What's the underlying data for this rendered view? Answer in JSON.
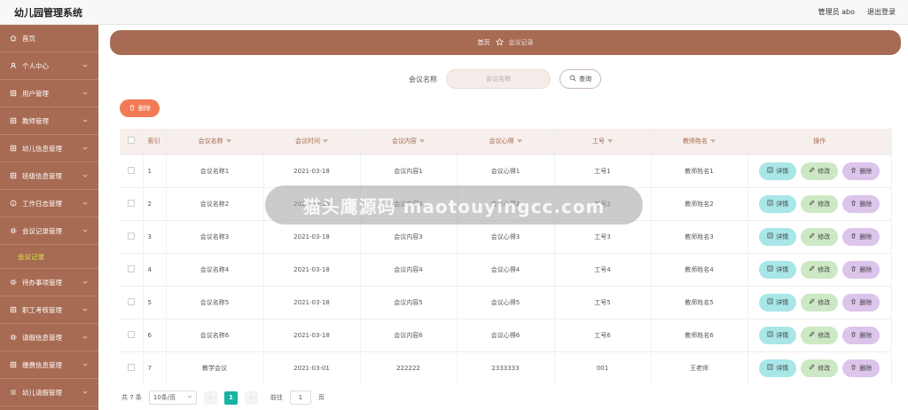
{
  "app": {
    "title": "幼儿园管理系统"
  },
  "header": {
    "user_label": "管理员 abo",
    "logout_label": "退出登录"
  },
  "sidebar": {
    "items": [
      {
        "label": "首页",
        "icon": "home-icon",
        "has_children": false
      },
      {
        "label": "个人中心",
        "icon": "user-icon",
        "has_children": true
      },
      {
        "label": "用户管理",
        "icon": "grid-icon",
        "has_children": true
      },
      {
        "label": "教师管理",
        "icon": "grid-icon",
        "has_children": true
      },
      {
        "label": "幼儿信息管理",
        "icon": "grid-icon",
        "has_children": true
      },
      {
        "label": "班级信息管理",
        "icon": "grid-icon",
        "has_children": true
      },
      {
        "label": "工作日志管理",
        "icon": "info-icon",
        "has_children": true
      },
      {
        "label": "会议记录管理",
        "icon": "gear-icon",
        "has_children": true,
        "expanded": true,
        "children": [
          {
            "label": "会议记录"
          }
        ]
      },
      {
        "label": "待办事项管理",
        "icon": "gear-icon",
        "has_children": true
      },
      {
        "label": "职工考核管理",
        "icon": "grid-icon",
        "has_children": true
      },
      {
        "label": "请假信息管理",
        "icon": "gear-icon",
        "has_children": true
      },
      {
        "label": "缴费信息管理",
        "icon": "grid-icon",
        "has_children": true
      },
      {
        "label": "幼儿请假管理",
        "icon": "list-icon",
        "has_children": true
      }
    ]
  },
  "breadcrumb": {
    "home": "首页",
    "current": "会议记录"
  },
  "search": {
    "label": "会议名称",
    "placeholder": "会议名称",
    "button_label": "查询"
  },
  "toolbar": {
    "delete_label": "删除"
  },
  "table": {
    "columns": [
      "索引",
      "会议名称",
      "会议时间",
      "会议内容",
      "会议心得",
      "工号",
      "教师姓名",
      "操作"
    ],
    "rows": [
      {
        "index": "1",
        "name": "会议名称1",
        "time": "2021-03-18",
        "content": "会议内容1",
        "insight": "会议心得1",
        "job_no": "工号1",
        "teacher": "教师姓名1"
      },
      {
        "index": "2",
        "name": "会议名称2",
        "time": "2021-03-18",
        "content": "会议内容2",
        "insight": "会议心得2",
        "job_no": "工号2",
        "teacher": "教师姓名2"
      },
      {
        "index": "3",
        "name": "会议名称3",
        "time": "2021-03-18",
        "content": "会议内容3",
        "insight": "会议心得3",
        "job_no": "工号3",
        "teacher": "教师姓名3"
      },
      {
        "index": "4",
        "name": "会议名称4",
        "time": "2021-03-18",
        "content": "会议内容4",
        "insight": "会议心得4",
        "job_no": "工号4",
        "teacher": "教师姓名4"
      },
      {
        "index": "5",
        "name": "会议名称5",
        "time": "2021-03-18",
        "content": "会议内容5",
        "insight": "会议心得5",
        "job_no": "工号5",
        "teacher": "教师姓名5"
      },
      {
        "index": "6",
        "name": "会议名称6",
        "time": "2021-03-18",
        "content": "会议内容6",
        "insight": "会议心得6",
        "job_no": "工号6",
        "teacher": "教师姓名6"
      },
      {
        "index": "7",
        "name": "教学会议",
        "time": "2021-03-01",
        "content": "222222",
        "insight": "2333333",
        "job_no": "001",
        "teacher": "王老师"
      }
    ],
    "actions": {
      "detail": "详情",
      "edit": "修改",
      "remove": "删除"
    }
  },
  "pagination": {
    "total_label": "共 7 条",
    "page_size": "10条/页",
    "current_page": "1",
    "goto_label": "前往",
    "goto_value": "1",
    "page_suffix": "页"
  },
  "watermark": {
    "text": "猫头鹰源码 maotouyingcc.com"
  },
  "colors": {
    "sidebar": "#a76a52",
    "accent": "#f27a55",
    "active_page": "#17b3a3",
    "submenu_active": "#d5e84a"
  }
}
